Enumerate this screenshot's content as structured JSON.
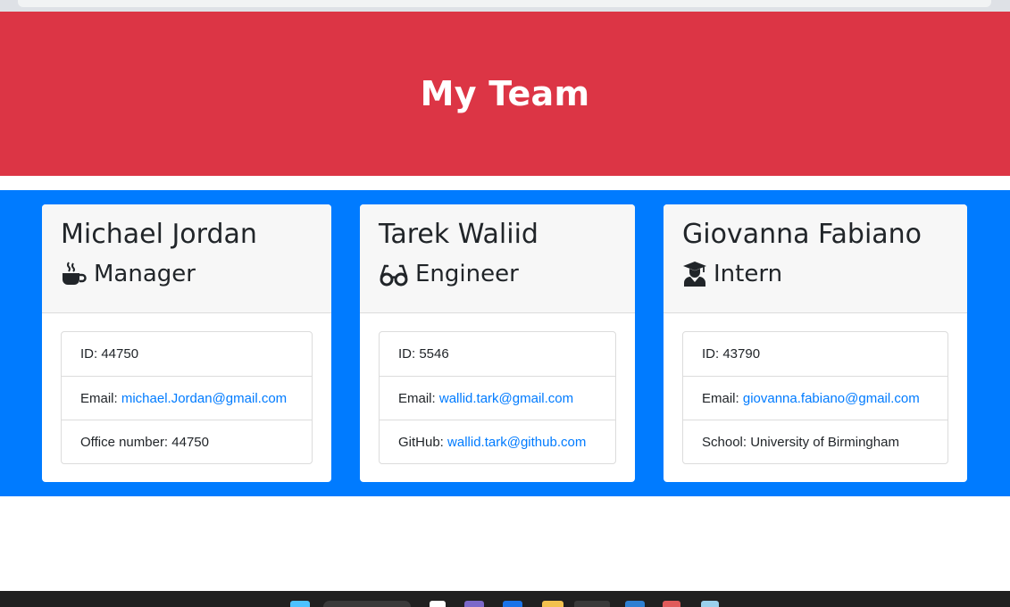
{
  "header": {
    "title": "My Team"
  },
  "colors": {
    "header_bg": "#dc3545",
    "team_bg": "#007bff",
    "link": "#007bff",
    "card_header_bg": "#f7f7f7"
  },
  "employees": [
    {
      "name": "Michael Jordan",
      "role": "Manager",
      "icon": "coffee-icon",
      "id_label": "ID:",
      "id_value": "44750",
      "email_label": "Email:",
      "email_value": "michael.Jordan@gmail.com",
      "extra_label": "Office number:",
      "extra_value": "44750",
      "extra_is_link": false
    },
    {
      "name": "Tarek Waliid",
      "role": "Engineer",
      "icon": "glasses-icon",
      "id_label": "ID:",
      "id_value": "5546",
      "email_label": "Email:",
      "email_value": "wallid.tark@gmail.com",
      "extra_label": "GitHub:",
      "extra_value": "wallid.tark@github.com",
      "extra_is_link": true
    },
    {
      "name": "Giovanna Fabiano",
      "role": "Intern",
      "icon": "graduate-icon",
      "id_label": "ID:",
      "id_value": "43790",
      "email_label": "Email:",
      "email_value": "giovanna.fabiano@gmail.com",
      "extra_label": "School:",
      "extra_value": "University of Birmingham",
      "extra_is_link": false
    }
  ]
}
